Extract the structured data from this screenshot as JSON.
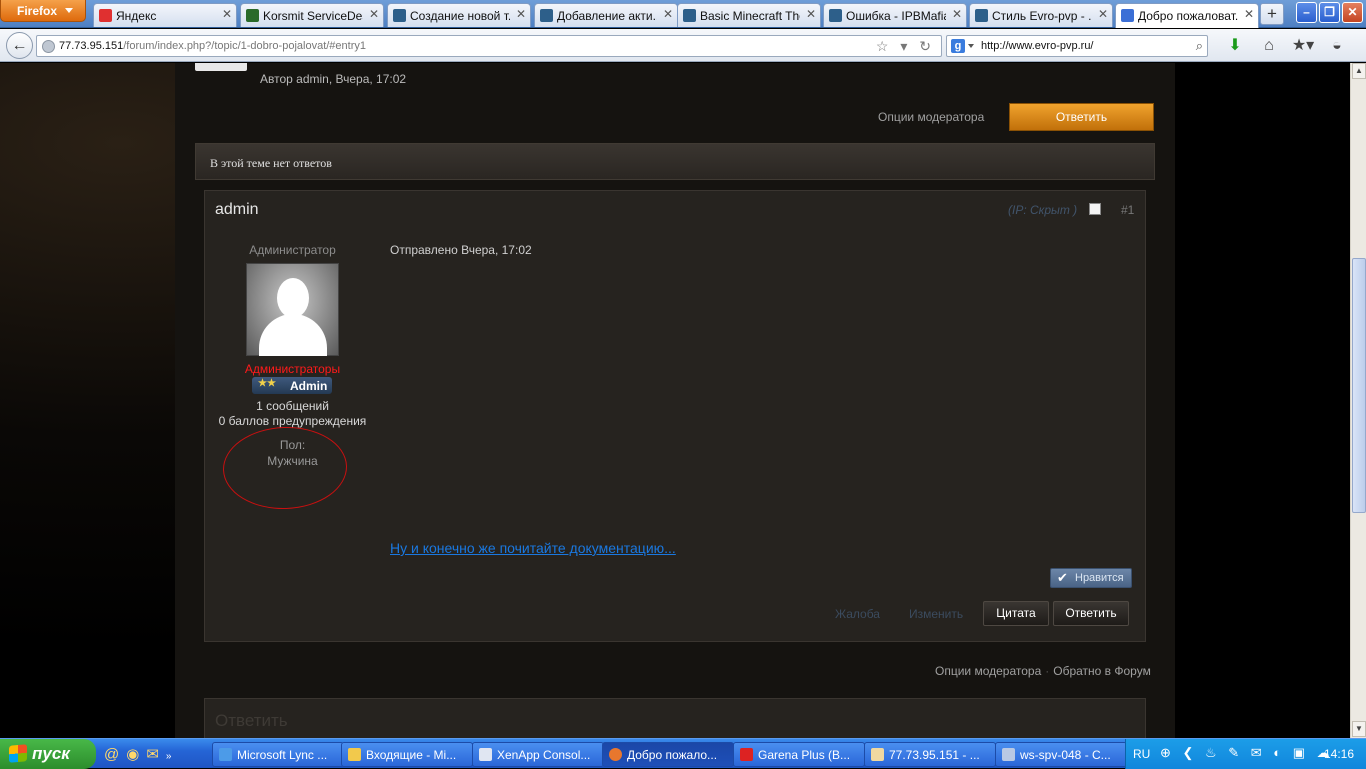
{
  "browser": {
    "firefox_label": "Firefox",
    "tabs": [
      {
        "label": "Яндекс",
        "icon_color": "#e03030"
      },
      {
        "label": "Korsmit ServiceDesk",
        "icon_color": "#2a6a2a"
      },
      {
        "label": "Создание новой т...",
        "icon_color": "#2d5f8a"
      },
      {
        "label": "Добавление акти...",
        "icon_color": "#2d5f8a"
      },
      {
        "label": "Basic Minecraft The...",
        "icon_color": "#2d5f8a"
      },
      {
        "label": "Ошибка - IPBMafia...",
        "icon_color": "#2d5f8a"
      },
      {
        "label": "Стиль Evro-pvp - ...",
        "icon_color": "#2d5f8a"
      },
      {
        "label": "Добро пожаловат...",
        "icon_color": "#3b6fd6"
      }
    ],
    "url_host": "77.73.95.151",
    "url_path": "/forum/index.php?/topic/1-dobro-pojalovat/#entry1",
    "search_value": "http://www.evro-pvp.ru/"
  },
  "topic": {
    "author_line": "Автор admin, Вчера, 17:02",
    "mod_options": "Опции модератора",
    "reply_label": "Ответить",
    "no_replies": "В этой теме нет ответов"
  },
  "post": {
    "username": "admin",
    "ip": "(IP: Скрыт )",
    "number": "#1",
    "role": "Администратор",
    "group": "Администраторы",
    "badge": "Admin",
    "posts": "1 сообщений",
    "warnings": "0 баллов предупреждения",
    "gender_label": "Пол:",
    "gender_value": "Мужчина",
    "sent": "Отправлено Вчера, 17:02",
    "doc_link": "Ну и конечно же почитайте документацию...",
    "like": "Нравится",
    "report": "Жалоба",
    "edit": "Изменить",
    "quote": "Цитата",
    "reply": "Ответить"
  },
  "footer": {
    "mod_options": "Опции модератора",
    "back": "Обратно в Форум",
    "reply_heading": "Ответить"
  },
  "taskbar": {
    "start": "пуск",
    "items": [
      "Microsoft Lync ...",
      "Входящие - Mi...",
      "XenApp Consol...",
      "Добро пожало...",
      "Garena Plus (B...",
      "77.73.95.151 - ...",
      "ws-spv-048 - C..."
    ],
    "lang": "RU",
    "clock": "14:16"
  }
}
